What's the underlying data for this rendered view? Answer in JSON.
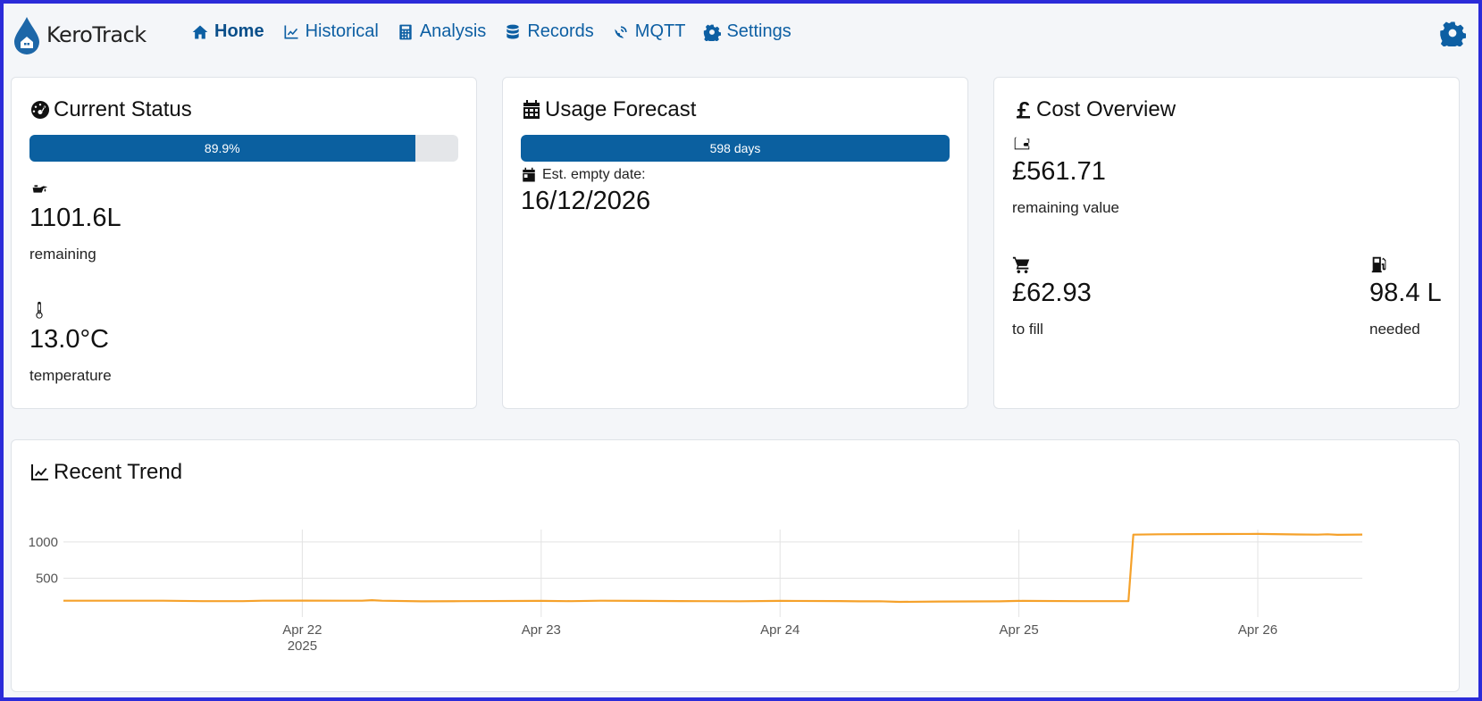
{
  "app": {
    "brand": "KeroTrack"
  },
  "nav": {
    "items": [
      {
        "label": "Home",
        "icon": "home-icon",
        "active": true
      },
      {
        "label": "Historical",
        "icon": "chart-line-icon"
      },
      {
        "label": "Analysis",
        "icon": "calculator-icon"
      },
      {
        "label": "Records",
        "icon": "database-icon"
      },
      {
        "label": "MQTT",
        "icon": "satellite-dish-icon"
      },
      {
        "label": "Settings",
        "icon": "gear-icon"
      }
    ],
    "theme_icon": "gear-icon"
  },
  "status": {
    "title": "Current Status",
    "level_label": "89.9%",
    "level_fraction": 0.899,
    "volume": "1101.6L",
    "volume_label": "remaining",
    "temperature": "13.0°C",
    "temperature_label": "temperature"
  },
  "forecast": {
    "title": "Usage Forecast",
    "days_label": "598 days",
    "empty_label": "Est. empty date:",
    "empty_date": "16/12/2026"
  },
  "cost": {
    "title": "Cost Overview",
    "remaining_value": "£561.71",
    "remaining_label": "remaining value",
    "to_fill": "£62.93",
    "to_fill_label": "to fill",
    "needed": "98.4 L",
    "needed_label": "needed"
  },
  "trend": {
    "title": "Recent Trend"
  },
  "colors": {
    "accent": "#0b60a0",
    "line": "#f5a12a"
  },
  "chart_data": {
    "type": "line",
    "x_ticks": [
      "Apr 22",
      "Apr 23",
      "Apr 24",
      "Apr 25",
      "Apr 26"
    ],
    "x_tick_sub": "2025",
    "y_ticks": [
      500,
      1000
    ],
    "ylim": [
      150,
      1170
    ],
    "xlim": [
      "2025-04-21T00:00",
      "2025-04-26T10:30"
    ],
    "series": [
      {
        "points": [
          [
            "2025-04-21T00:00",
            190
          ],
          [
            "2025-04-21T10:00",
            190
          ],
          [
            "2025-04-21T14:00",
            185
          ],
          [
            "2025-04-21T18:00",
            185
          ],
          [
            "2025-04-21T20:00",
            190
          ],
          [
            "2025-04-22T00:00",
            192
          ],
          [
            "2025-04-22T06:00",
            190
          ],
          [
            "2025-04-22T07:00",
            198
          ],
          [
            "2025-04-22T08:00",
            190
          ],
          [
            "2025-04-22T12:00",
            182
          ],
          [
            "2025-04-22T16:00",
            185
          ],
          [
            "2025-04-23T00:00",
            188
          ],
          [
            "2025-04-23T03:00",
            185
          ],
          [
            "2025-04-23T06:00",
            190
          ],
          [
            "2025-04-23T10:00",
            188
          ],
          [
            "2025-04-23T16:00",
            185
          ],
          [
            "2025-04-23T20:00",
            183
          ],
          [
            "2025-04-24T00:00",
            188
          ],
          [
            "2025-04-24T06:00",
            186
          ],
          [
            "2025-04-24T08:00",
            182
          ],
          [
            "2025-04-24T10:00",
            183
          ],
          [
            "2025-04-24T12:00",
            175
          ],
          [
            "2025-04-24T16:00",
            180
          ],
          [
            "2025-04-24T22:00",
            182
          ],
          [
            "2025-04-25T00:00",
            188
          ],
          [
            "2025-04-25T06:00",
            185
          ],
          [
            "2025-04-25T11:00",
            185
          ],
          [
            "2025-04-25T11:30",
            1100
          ],
          [
            "2025-04-25T14:00",
            1105
          ],
          [
            "2025-04-25T20:00",
            1108
          ],
          [
            "2025-04-26T00:00",
            1110
          ],
          [
            "2025-04-26T04:00",
            1102
          ],
          [
            "2025-04-26T06:00",
            1100
          ],
          [
            "2025-04-26T07:00",
            1105
          ],
          [
            "2025-04-26T08:00",
            1098
          ],
          [
            "2025-04-26T10:30",
            1101.6
          ]
        ]
      }
    ],
    "grid": true
  }
}
